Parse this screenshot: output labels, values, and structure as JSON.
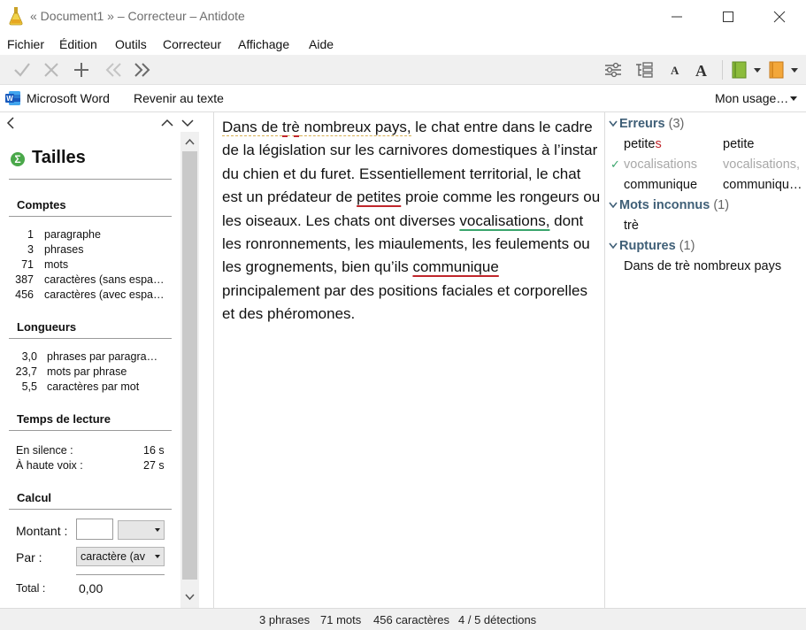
{
  "window": {
    "title": "« Document1 » – Correcteur – Antidote"
  },
  "menu": [
    "Fichier",
    "Édition",
    "Outils",
    "Correcteur",
    "Affichage",
    "Aide"
  ],
  "context_bar": {
    "app_name": "Microsoft Word",
    "return_label": "Revenir au texte",
    "usage_label": "Mon usage…"
  },
  "left_panel": {
    "title": "Tailles",
    "comptes": {
      "heading": "Comptes",
      "rows": [
        {
          "value": "1",
          "label": "paragraphe"
        },
        {
          "value": "3",
          "label": "phrases"
        },
        {
          "value": "71",
          "label": "mots"
        },
        {
          "value": "387",
          "label": "caractères (sans espa…"
        },
        {
          "value": "456",
          "label": "caractères (avec espa…"
        }
      ]
    },
    "longueurs": {
      "heading": "Longueurs",
      "rows": [
        {
          "value": "3,0",
          "label": "phrases par paragra…"
        },
        {
          "value": "23,7",
          "label": "mots par phrase"
        },
        {
          "value": "5,5",
          "label": "caractères par mot"
        }
      ]
    },
    "lecture": {
      "heading": "Temps de lecture",
      "silence_label": "En silence :",
      "silence_value": "16 s",
      "haute_voix_label": "À haute voix :",
      "haute_voix_value": "27 s"
    },
    "calcul": {
      "heading": "Calcul",
      "montant_label": "Montant :",
      "montant_value": "",
      "montant_unit": "",
      "par_label": "Par :",
      "par_value": "caractère (av",
      "total_label": "Total :",
      "total_value": "0,00"
    }
  },
  "editor": {
    "segments": [
      {
        "text": "Dans de ",
        "style": "break"
      },
      {
        "text": "trè",
        "style": "break unknown"
      },
      {
        "text": " nombreux pays,",
        "style": "break"
      },
      {
        "text": " le chat entre dans le cadre de la législation sur les carnivores domestiques à l’instar du chien et du furet. Essentiellement territorial, le chat est un prédateur de ",
        "style": ""
      },
      {
        "text": "petites",
        "style": "red"
      },
      {
        "text": " proie comme les rongeurs ou les oiseaux. Les chats ont diverses ",
        "style": ""
      },
      {
        "text": "vocalisations,",
        "style": "green"
      },
      {
        "text": " dont les ronronnements, les miaulements, les feulements ou les grognements, bien qu’ils ",
        "style": ""
      },
      {
        "text": "communique",
        "style": "red"
      },
      {
        "text": " principalement par des positions faciales et corporelles et des phéromones.",
        "style": ""
      }
    ]
  },
  "right_panel": {
    "errors": {
      "label": "Erreurs",
      "count": "(3)",
      "items": [
        {
          "original_prefix": "petite",
          "original_suffix": "s",
          "correction": "petite",
          "resolved": false
        },
        {
          "original_prefix": "vocalisations",
          "original_suffix": "",
          "correction": "vocalisations,",
          "resolved": true
        },
        {
          "original_prefix": "communique",
          "original_suffix": "",
          "correction": "communiqu…",
          "resolved": false
        }
      ]
    },
    "unknown": {
      "label": "Mots inconnus",
      "count": "(1)",
      "items": [
        "trè"
      ]
    },
    "breaks": {
      "label": "Ruptures",
      "count": "(1)",
      "items": [
        "Dans de trè nombreux pays"
      ]
    }
  },
  "status": {
    "phrases": "3 phrases",
    "mots": "71 mots",
    "caracteres": "456 caractères",
    "detections": "4 / 5 détections"
  },
  "colors": {
    "error_red": "#c0262b",
    "correction_green": "#3aa56c",
    "section_blue": "#3f5f77"
  }
}
